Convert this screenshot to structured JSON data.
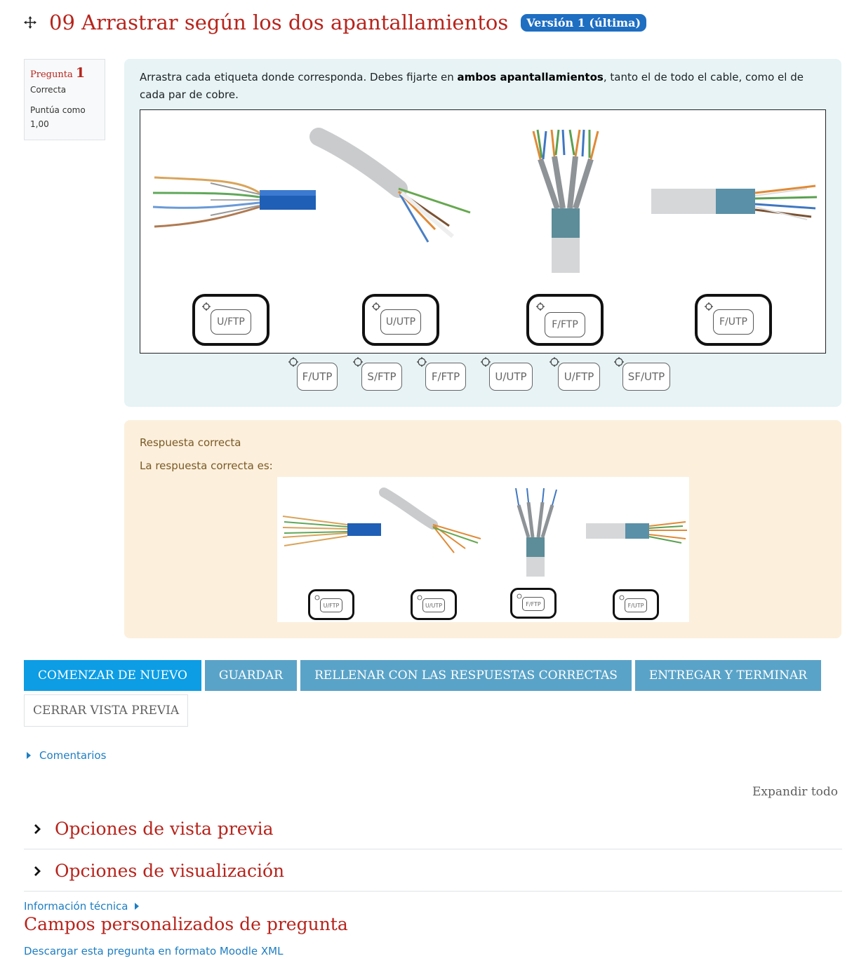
{
  "header": {
    "title": "09 Arrastrar según los dos apantallamientos",
    "version_badge": "Versión 1 (última)"
  },
  "info": {
    "question_label": "Pregunta",
    "question_number": "1",
    "state": "Correcta",
    "grade": "Puntúa como 1,00"
  },
  "question": {
    "text_before": "Arrastra cada etiqueta donde corresponda. Debes fijarte en ",
    "text_bold": "ambos apantallamientos",
    "text_after": ", tanto el de todo el cable, como el de cada par de cobre.",
    "drop_zones": [
      "U/FTP",
      "U/UTP",
      "F/FTP",
      "F/UTP"
    ],
    "drag_items": [
      "F/UTP",
      "S/FTP",
      "F/FTP",
      "U/UTP",
      "U/FTP",
      "SF/UTP"
    ]
  },
  "feedback": {
    "state_text": "Respuesta correcta",
    "right_answer_label": "La respuesta correcta es:",
    "answer_labels": [
      "U/FTP",
      "U/UTP",
      "F/FTP",
      "F/UTP"
    ]
  },
  "actions": {
    "restart": "COMENZAR DE NUEVO",
    "save": "GUARDAR",
    "fill_correct": "RELLENAR CON LAS RESPUESTAS CORRECTAS",
    "submit": "ENTREGAR Y TERMINAR",
    "close_preview": "CERRAR VISTA PREVIA"
  },
  "comments_link": "Comentarios",
  "expand_all": "Expandir todo",
  "sections": [
    "Opciones de vista previa",
    "Opciones de visualización"
  ],
  "tech_info": "Información técnica",
  "custom_fields_heading": "Campos personalizados de pregunta",
  "download_link": "Descargar esta pregunta en formato Moodle XML",
  "colors": {
    "title_red": "#b7241c",
    "badge_blue": "#1e6ec2",
    "formulation_bg": "#e7f3f5",
    "feedback_bg": "#fcefdc",
    "primary_button": "#0c9de4",
    "secondary_button": "#5aa3c8",
    "link_blue": "#1e7ec2"
  }
}
